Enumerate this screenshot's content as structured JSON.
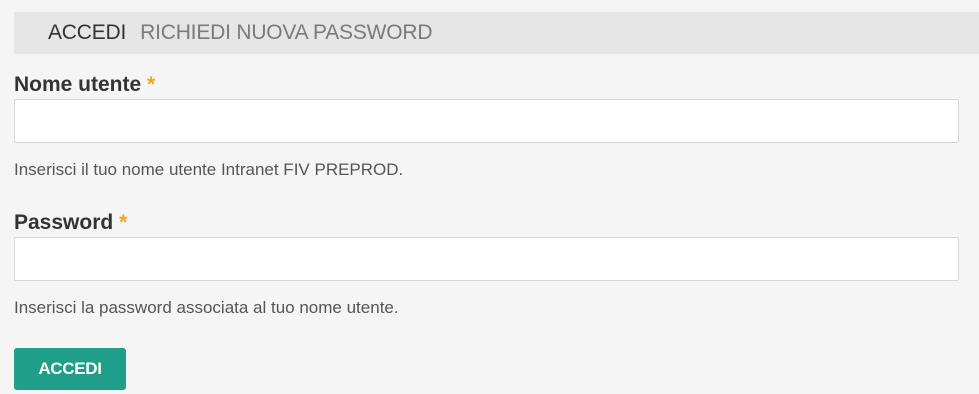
{
  "tabs": {
    "login": "ACCEDI",
    "reset_password": "RICHIEDI NUOVA PASSWORD"
  },
  "username": {
    "label": "Nome utente",
    "required_mark": "*",
    "value": "",
    "help": "Inserisci il tuo nome utente Intranet FIV PREPROD."
  },
  "password": {
    "label": "Password",
    "required_mark": "*",
    "value": "",
    "help": "Inserisci la password associata al tuo nome utente."
  },
  "submit": {
    "label": "ACCEDI"
  },
  "colors": {
    "accent": "#1f9e8a",
    "required": "#f5a623",
    "tab_bar": "#e6e6e6"
  }
}
